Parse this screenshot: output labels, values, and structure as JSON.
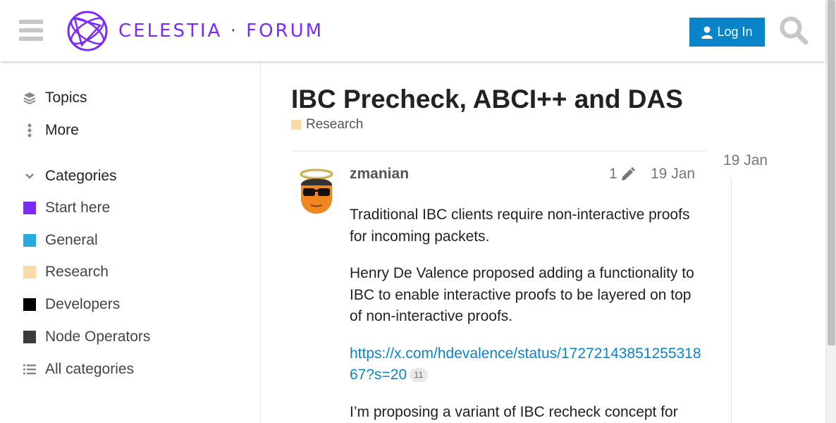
{
  "header": {
    "logo_text": "CELESTIA · FORUM",
    "login_label": "Log In"
  },
  "sidebar": {
    "topics_label": "Topics",
    "more_label": "More",
    "categories_label": "Categories",
    "categories": [
      {
        "label": "Start here",
        "color": "#7b2bf9"
      },
      {
        "label": "General",
        "color": "#25aae1"
      },
      {
        "label": "Research",
        "color": "#fad8a8"
      },
      {
        "label": "Developers",
        "color": "#000000"
      },
      {
        "label": "Node Operators",
        "color": "#3c3c3c"
      }
    ],
    "all_categories_label": "All categories"
  },
  "topic": {
    "title": "IBC Precheck, ABCI++ and DAS",
    "category": "Research"
  },
  "post": {
    "username": "zmanian",
    "edit_count": "1",
    "date": "19 Jan",
    "paragraphs": [
      "Traditional IBC clients require non-interactive proofs for incoming packets.",
      "Henry De Valence proposed adding a functionality to IBC to enable interactive proofs to be layered on top of non-interactive proofs."
    ],
    "link_text": "https://x.com/hdevalence/status/1727214385125531867?s=20",
    "link_clicks": "11",
    "last_paragraph": "I’m proposing a variant of IBC recheck concept for"
  },
  "timeline": {
    "date": "19 Jan"
  }
}
